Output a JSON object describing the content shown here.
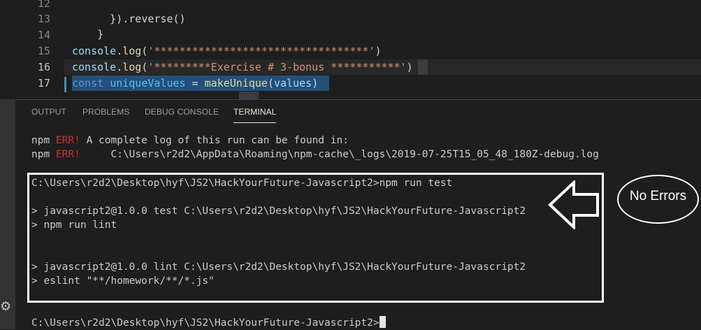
{
  "editor": {
    "line_numbers": [
      "12",
      "13",
      "14",
      "15",
      "16",
      "17"
    ],
    "lines": {
      "l12": "  }).reverse()",
      "l13": "}",
      "l14": "",
      "l15_fn": "console",
      "l15_dot": ".",
      "l15_log": "log",
      "l15_open": "(",
      "l15_str": "'**********************************'",
      "l15_close": ")",
      "l16_fn": "console",
      "l16_dot": ".",
      "l16_log": "log",
      "l16_open": "(",
      "l16_str": "'*********Exercise # 3-bonus ***********'",
      "l16_close": ")",
      "l17_kw": "const",
      "l17_var": "uniqueValues",
      "l17_eq": " = ",
      "l17_fn": "makeUnique",
      "l17_open": "(",
      "l17_arg": "values",
      "l17_close": ")"
    }
  },
  "panel": {
    "tabs": [
      "OUTPUT",
      "PROBLEMS",
      "DEBUG CONSOLE",
      "TERMINAL"
    ],
    "active_tab": "TERMINAL",
    "terminal": {
      "l1_prefix": "npm ",
      "l1_err": "ERR!",
      "l1_rest": " A complete log of this run can be found in:",
      "l2_prefix": "npm ",
      "l2_err": "ERR!",
      "l2_rest": "     C:\\Users\\r2d2\\AppData\\Roaming\\npm-cache\\_logs\\2019-07-25T15_05_48_180Z-debug.log",
      "l3": "C:\\Users\\r2d2\\Desktop\\hyf\\JS2\\HackYourFuture-Javascript2>npm run test",
      "l4": "> javascript2@1.0.0 test C:\\Users\\r2d2\\Desktop\\hyf\\JS2\\HackYourFuture-Javascript2",
      "l5": "> npm run lint",
      "l6": "> javascript2@1.0.0 lint C:\\Users\\r2d2\\Desktop\\hyf\\JS2\\HackYourFuture-Javascript2",
      "l7": "> eslint \"**/homework/**/*.js\"",
      "l8": "C:\\Users\\r2d2\\Desktop\\hyf\\JS2\\HackYourFuture-Javascript2>"
    }
  },
  "annotation": {
    "label": "No Errors"
  },
  "colors": {
    "background": "#1e1e1e",
    "error_red": "#cd3131",
    "annotation_white": "#ffffff",
    "selection_blue": "#264f78"
  },
  "icons": [
    "arrow-left-icon",
    "gear-icon"
  ]
}
